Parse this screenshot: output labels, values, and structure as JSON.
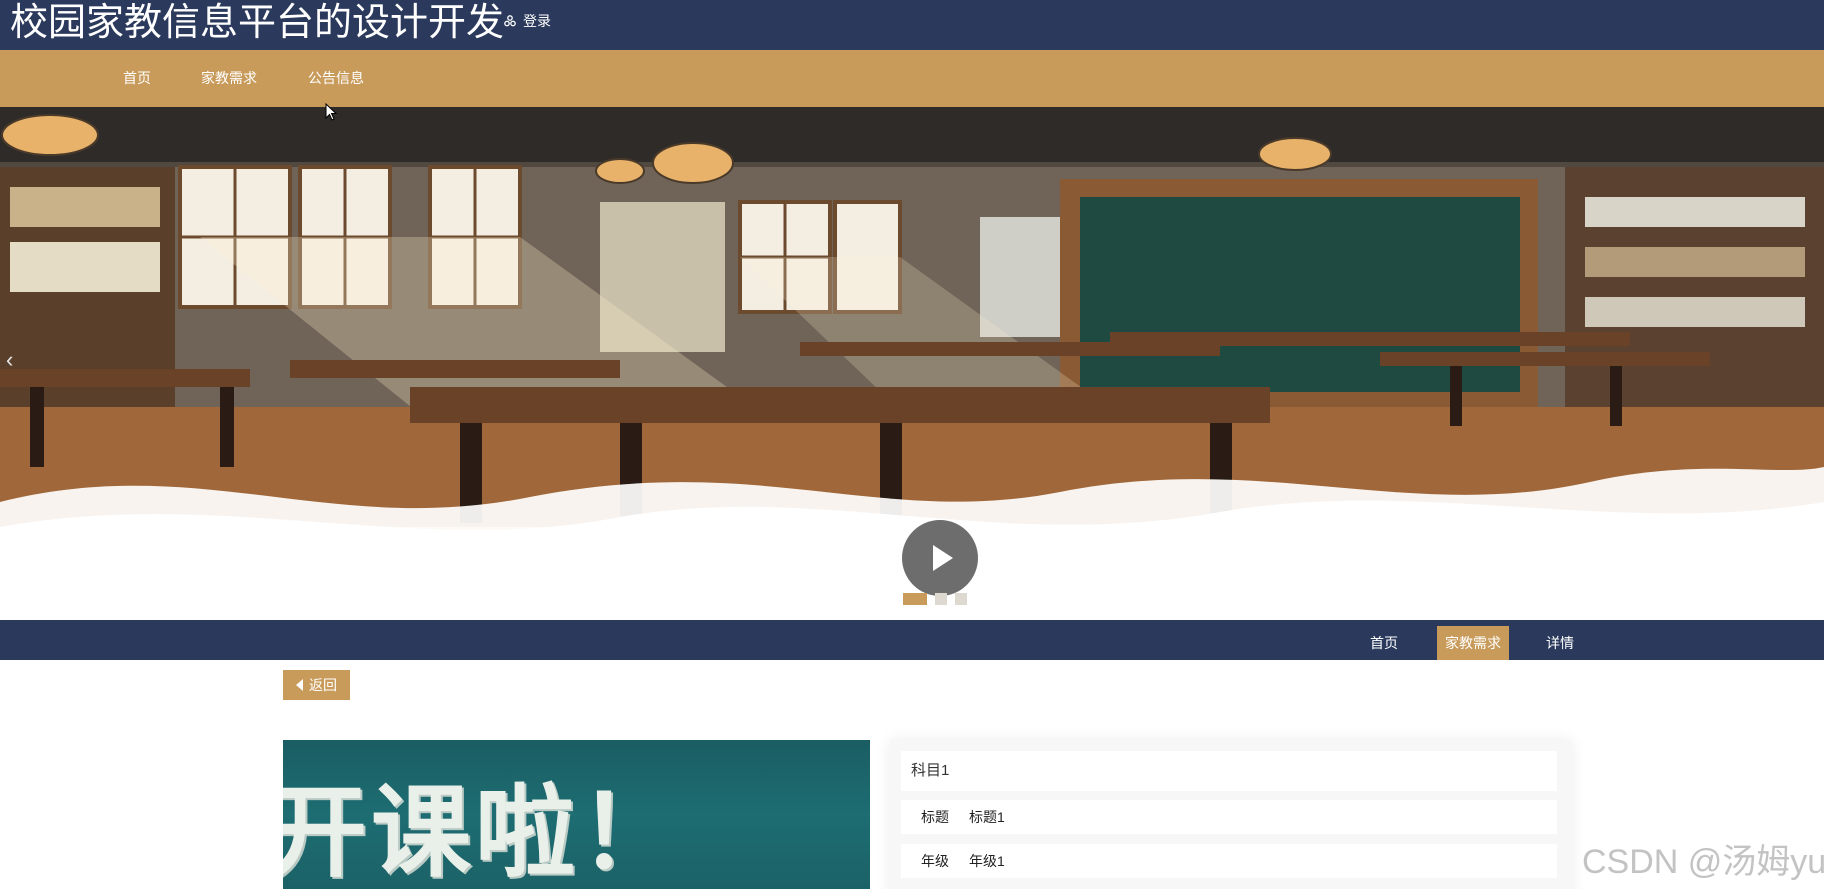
{
  "header": {
    "site_title": "校园家教信息平台的设计开发",
    "login_label": "登录"
  },
  "main_nav": {
    "items": [
      {
        "label": "首页"
      },
      {
        "label": "家教需求"
      },
      {
        "label": "公告信息"
      }
    ]
  },
  "banner": {
    "prev_arrow": "‹",
    "slide_count": 3,
    "active_slide": 1
  },
  "breadcrumb": {
    "items": [
      {
        "label": "首页",
        "active": false
      },
      {
        "label": "家教需求",
        "active": true
      },
      {
        "label": "详情",
        "active": false
      }
    ]
  },
  "back_button": {
    "label": "返回"
  },
  "detail": {
    "image_text": "开课啦！",
    "subject": "科目1",
    "fields": [
      {
        "key": "标题",
        "value": "标题1"
      },
      {
        "key": "年级",
        "value": "年级1"
      }
    ]
  },
  "watermark": "CSDN @汤姆yu",
  "colors": {
    "navy": "#2b3a5c",
    "accent": "#c99b5b",
    "white": "#ffffff"
  }
}
